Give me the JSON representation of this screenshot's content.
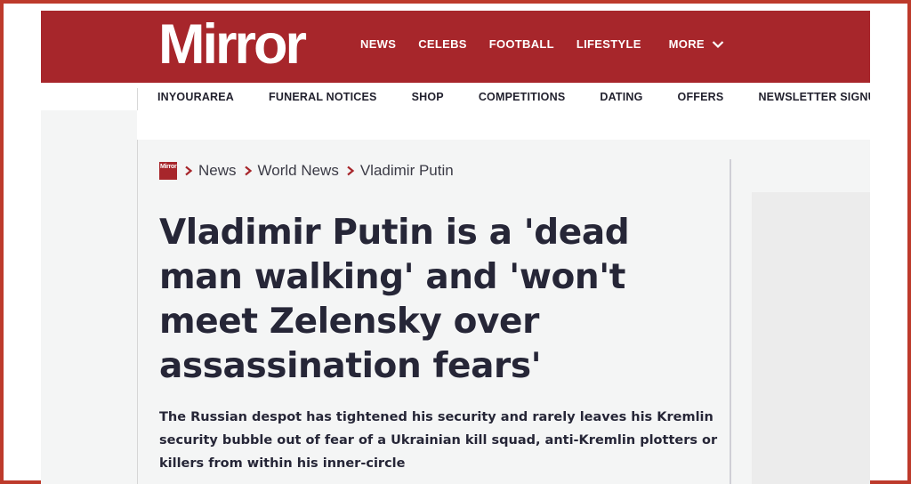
{
  "brand": {
    "logo_text": "Mirror",
    "accent": "#a7262b"
  },
  "main_nav": {
    "items": [
      {
        "label": "NEWS"
      },
      {
        "label": "CELEBS"
      },
      {
        "label": "FOOTBALL"
      },
      {
        "label": "LIFESTYLE"
      }
    ],
    "more_label": "MORE"
  },
  "sub_nav": {
    "items": [
      {
        "label": "INYOURAREA"
      },
      {
        "label": "FUNERAL NOTICES"
      },
      {
        "label": "SHOP"
      },
      {
        "label": "COMPETITIONS"
      },
      {
        "label": "DATING"
      },
      {
        "label": "OFFERS"
      },
      {
        "label": "NEWSLETTER SIGNUP"
      }
    ]
  },
  "breadcrumb": {
    "logo_text": "Mirror",
    "items": [
      {
        "label": "News"
      },
      {
        "label": "World News"
      },
      {
        "label": "Vladimir Putin"
      }
    ]
  },
  "article": {
    "headline": "Vladimir Putin is a 'dead man walking' and 'won't meet Zelensky over assassination fears'",
    "standfirst": "The Russian despot has tightened his security and rarely leaves his Kremlin security bubble out of fear of a Ukrainian kill squad, anti-Kremlin plotters or killers from within his inner-circle"
  }
}
